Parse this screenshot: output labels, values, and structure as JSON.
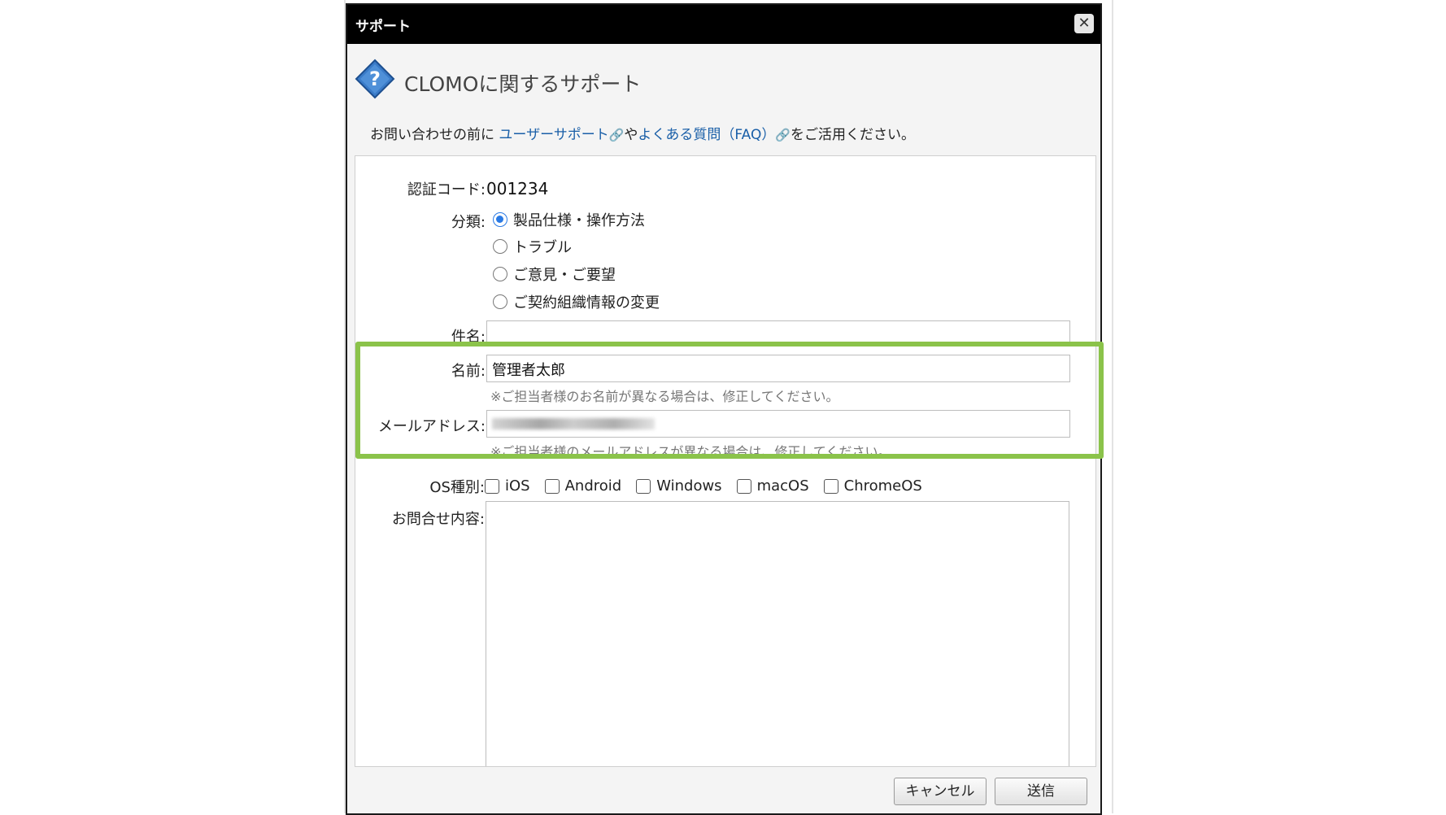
{
  "dialog": {
    "title": "サポート",
    "close_symbol": "✕"
  },
  "header": {
    "title": "CLOMOに関するサポート",
    "icon": "help-question-icon"
  },
  "intro": {
    "prefix": "お問い合わせの前に",
    "link_support": "ユーザーサポート",
    "connector": "や",
    "link_faq": "よくある質問（FAQ）",
    "suffix": "をご活用ください。",
    "external_link_icon": "🔗"
  },
  "form": {
    "auth_code": {
      "label": "認証コード:",
      "value": "001234"
    },
    "category": {
      "label": "分類:",
      "options": [
        {
          "label": "製品仕様・操作方法",
          "checked": true
        },
        {
          "label": "トラブル",
          "checked": false
        },
        {
          "label": "ご意見・ご要望",
          "checked": false
        },
        {
          "label": "ご契約組織情報の変更",
          "checked": false
        }
      ]
    },
    "subject": {
      "label": "件名:",
      "value": ""
    },
    "name": {
      "label": "名前:",
      "value": "管理者太郎",
      "note": "※ご担当者様のお名前が異なる場合は、修正してください。"
    },
    "email": {
      "label": "メールアドレス:",
      "note": "※ご担当者様のメールアドレスが異なる場合は、修正してください。"
    },
    "os": {
      "label": "OS種別:",
      "options": [
        {
          "label": "iOS",
          "checked": false
        },
        {
          "label": "Android",
          "checked": false
        },
        {
          "label": "Windows",
          "checked": false
        },
        {
          "label": "macOS",
          "checked": false
        },
        {
          "label": "ChromeOS",
          "checked": false
        }
      ]
    },
    "inquiry": {
      "label": "お問合せ内容:",
      "value": ""
    }
  },
  "buttons": {
    "cancel": "キャンセル",
    "submit": "送信"
  },
  "colors": {
    "highlight": "#8bc34a",
    "link": "#1a5fa8",
    "radio_accent": "#2a7ae4"
  }
}
